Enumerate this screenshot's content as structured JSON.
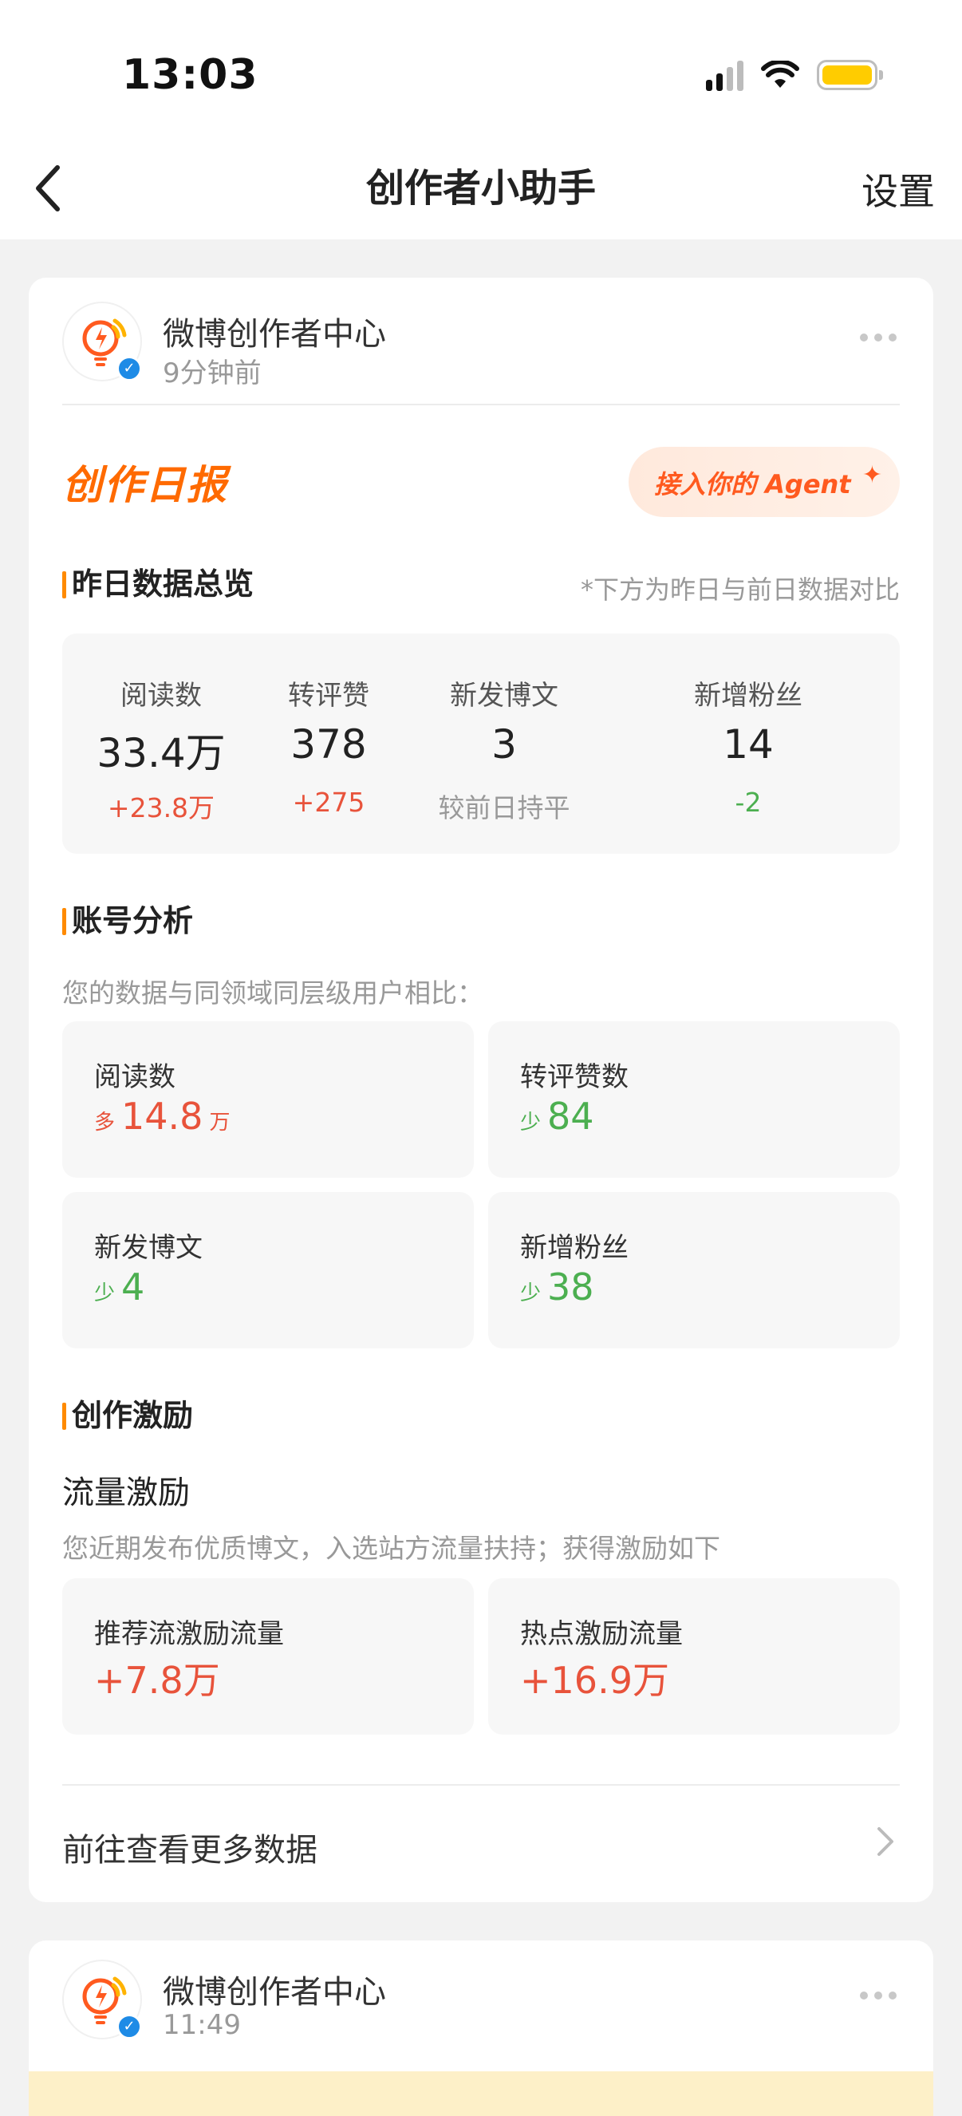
{
  "status_bar": {
    "time": "13:03"
  },
  "nav": {
    "title": "创作者小助手",
    "settings_label": "设置"
  },
  "post": {
    "account_name": "微博创作者中心",
    "time": "9分钟前",
    "report_title": "创作日报",
    "agent_button_label": "接入你的 Agent",
    "overview": {
      "title": "昨日数据总览",
      "note": "*下方为昨日与前日数据对比",
      "items": [
        {
          "label": "阅读数",
          "value": "33.4万",
          "delta": "+23.8万",
          "trend": "up"
        },
        {
          "label": "转评赞",
          "value": "378",
          "delta": "+275",
          "trend": "up"
        },
        {
          "label": "新发博文",
          "value": "3",
          "delta": "较前日持平",
          "trend": "flat"
        },
        {
          "label": "新增粉丝",
          "value": "14",
          "delta": "-2",
          "trend": "down"
        }
      ]
    },
    "analysis": {
      "title": "账号分析",
      "note": "您的数据与同领域同层级用户相比：",
      "tiles": [
        {
          "label": "阅读数",
          "prefix": "多",
          "value": "14.8",
          "unit": "万",
          "trend": "up"
        },
        {
          "label": "转评赞数",
          "prefix": "少",
          "value": "84",
          "unit": "",
          "trend": "down"
        },
        {
          "label": "新发博文",
          "prefix": "少",
          "value": "4",
          "unit": "",
          "trend": "down"
        },
        {
          "label": "新增粉丝",
          "prefix": "少",
          "value": "38",
          "unit": "",
          "trend": "down"
        }
      ]
    },
    "incentive": {
      "title": "创作激励",
      "subtitle": "流量激励",
      "desc": "您近期发布优质博文，入选站方流量扶持；获得激励如下",
      "tiles": [
        {
          "label": "推荐流激励流量",
          "value": "+7.8万"
        },
        {
          "label": "热点激励流量",
          "value": "+16.9万"
        }
      ]
    },
    "more_data_label": "前往查看更多数据"
  },
  "post2": {
    "account_name": "微博创作者中心",
    "time": "11:49"
  },
  "colors": {
    "accent_orange": "#ff6a00",
    "up_red": "#e8533b",
    "down_green": "#4caf50",
    "verified_blue": "#1e8be6"
  }
}
